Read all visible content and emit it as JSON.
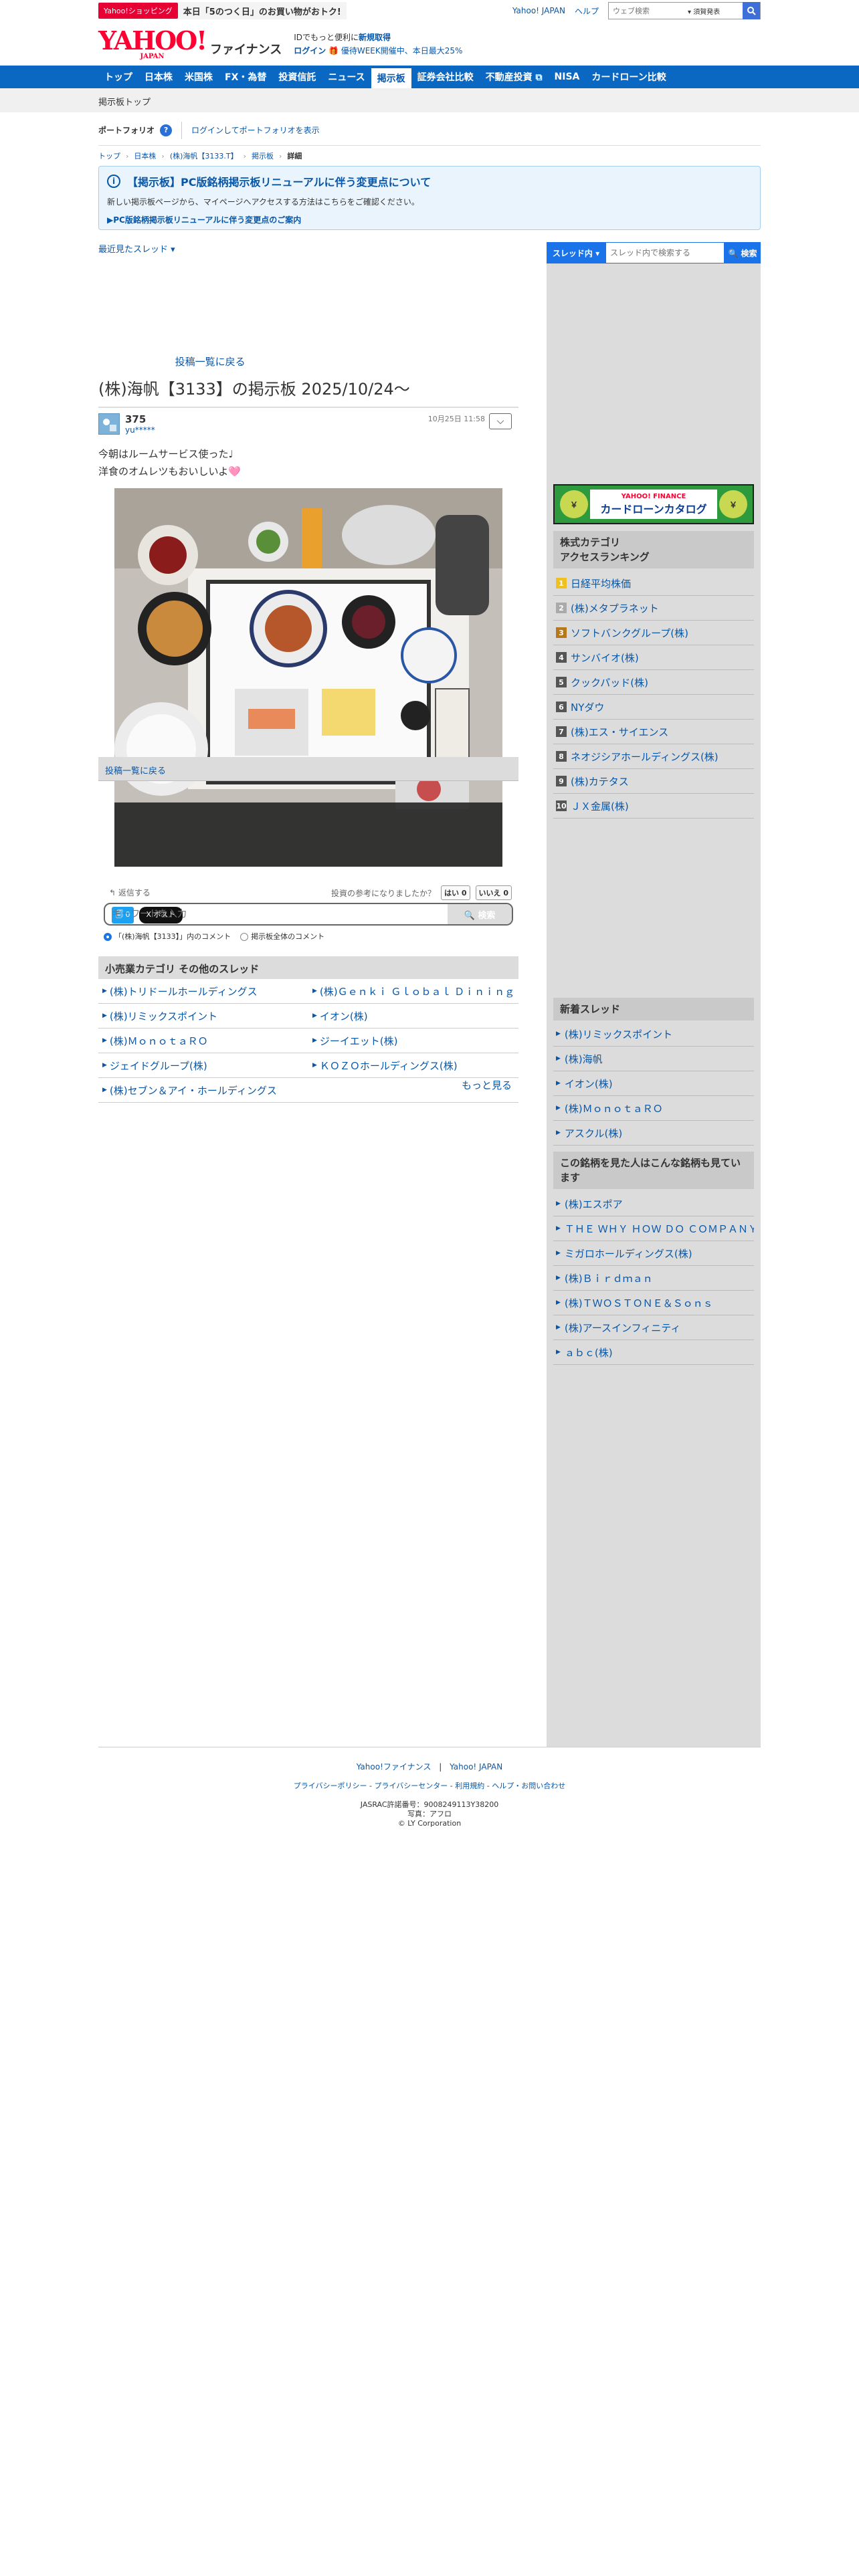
{
  "top": {
    "promo_tag": "Yahoo!ショッピング",
    "promo_text": "本日「5のつく日」のお買い物がおトク!",
    "link_japan": "Yahoo! JAPAN",
    "link_help": "ヘルプ",
    "search_placeholder": "ウェブ検索",
    "search_option": "▾ 須賀発表"
  },
  "header": {
    "logo": "YAHOO!",
    "logo_sub": "JAPAN",
    "service": "ファイナンス",
    "id_promo": "IDでもっと便利に",
    "id_promo_link": "新規取得",
    "login": "ログイン",
    "campaign": "🎁 優待WEEK開催中、本日最大25%"
  },
  "nav": {
    "items": [
      "トップ",
      "日本株",
      "米国株",
      "FX・為替",
      "投資信託",
      "ニュース",
      "掲示板",
      "証券会社比較",
      "不動産投資 ⧉",
      "NISA",
      "カードローン比較"
    ]
  },
  "subnav": {
    "label": "掲示板トップ"
  },
  "portfolio": {
    "label": "ポートフォリオ",
    "help": "?",
    "login_link": "ログインしてポートフォリオを表示"
  },
  "breadcrumb": [
    "トップ",
    "日本株",
    "(株)海帆【3133.T】",
    "掲示板",
    "詳細"
  ],
  "notice": {
    "icon": "i",
    "title": "【掲示板】PC版銘柄掲示板リニューアルに伴う変更点について",
    "body": "新しい掲示板ページから、マイページへアクセスする方法はこちらをご確認ください。",
    "link": "▶PC版銘柄掲示板リニューアルに伴う変更点のご案内"
  },
  "main": {
    "recent_threads": "最近見たスレッド ▾",
    "back_to_list": "投稿一覧に戻る",
    "thread_title": "(株)海帆【3133】の掲示板 2025/10/24〜",
    "post": {
      "number": "375",
      "user": "yu*****",
      "date": "10月25日 11:58",
      "menu": "⌵",
      "line1": "今朝はルームサービス使った♩",
      "line2": "洋食のオムレツもおいしいよ🩷",
      "reply": "↰ 返信する",
      "helpful_q": "投資の参考になりましたか？",
      "yes": "はい 0",
      "no": "いいえ 0",
      "share_fb": "🗐 0",
      "share_x": "X ポスト"
    },
    "back_bar": "投稿一覧に戻る",
    "keyword_placeholder": "キーワードを入力",
    "search_btn": "🔍 検索",
    "radio_in_thread": "「(株)海帆【3133】」内のコメント",
    "radio_all": "掲示板全体のコメント",
    "category_heading": "小売業カテゴリ その他のスレッド",
    "category_threads": [
      [
        "(株)トリドールホールディングス",
        "(株)Ｇｅｎｋｉ Ｇｌｏｂａｌ Ｄｉｎｉｎｇ"
      ],
      [
        "(株)リミックスポイント",
        "イオン(株)"
      ],
      [
        "(株)ＭｏｎｏｔａＲＯ",
        "ジーイエット(株)"
      ],
      [
        "ジェイドグループ(株)",
        "ＫＯＺＯホールディングス(株)"
      ],
      [
        "(株)セブン＆アイ・ホールディングス",
        ""
      ]
    ],
    "more": "もっと見る"
  },
  "side": {
    "search_select": "スレッド内 ▾",
    "search_placeholder": "スレッド内で検索する",
    "search_go": "🔍 検索",
    "banner_yahoo": "YAHOO! FINANCE",
    "banner_text": "カードローンカタログ",
    "banner_coin": "￥",
    "ranking_heading": "株式カテゴリ\nアクセスランキング",
    "ranking": [
      "日経平均株価",
      "(株)メタプラネット",
      "ソフトバンクグループ(株)",
      "サンバイオ(株)",
      "クックパッド(株)",
      "NYダウ",
      "(株)エス・サイエンス",
      "ネオジシアホールディングス(株)",
      "(株)カテタス",
      "ＪＸ金属(株)"
    ],
    "new_heading": "新着スレッド",
    "new_threads": [
      "(株)リミックスポイント",
      "(株)海帆",
      "イオン(株)",
      "(株)ＭｏｎｏｔａＲＯ",
      "アスクル(株)"
    ],
    "also_heading": "この銘柄を見た人はこんな銘柄も見ています",
    "also_threads": [
      "(株)エスポア",
      "ＴＨＥ ＷＨＹ ＨＯＷ ＤＯ ＣＯＭＰＡＮＹ(株)",
      "ミガロホールディングス(株)",
      "(株)Ｂｉｒｄｍａｎ",
      "(株)ＴＷＯＳＴＯＮＥ＆Ｓｏｎｓ",
      "(株)アースインフィニティ",
      "ａｂｃ(株)"
    ]
  },
  "footer": {
    "link1": "Yahoo!ファイナンス",
    "link2": "Yahoo! JAPAN",
    "sep": "|",
    "links": [
      "プライバシーポリシー",
      "プライバシーセンター",
      "利用規約",
      "ヘルプ・お問い合わせ"
    ],
    "jasrac": "JASRAC許諾番号：9008249113Y38200",
    "photo": "写真：アフロ",
    "copyright": "© LY Corporation"
  },
  "colors": {
    "brand_red": "#ff0033",
    "nav_blue": "#0a67c2",
    "link_blue": "#0857a8"
  }
}
